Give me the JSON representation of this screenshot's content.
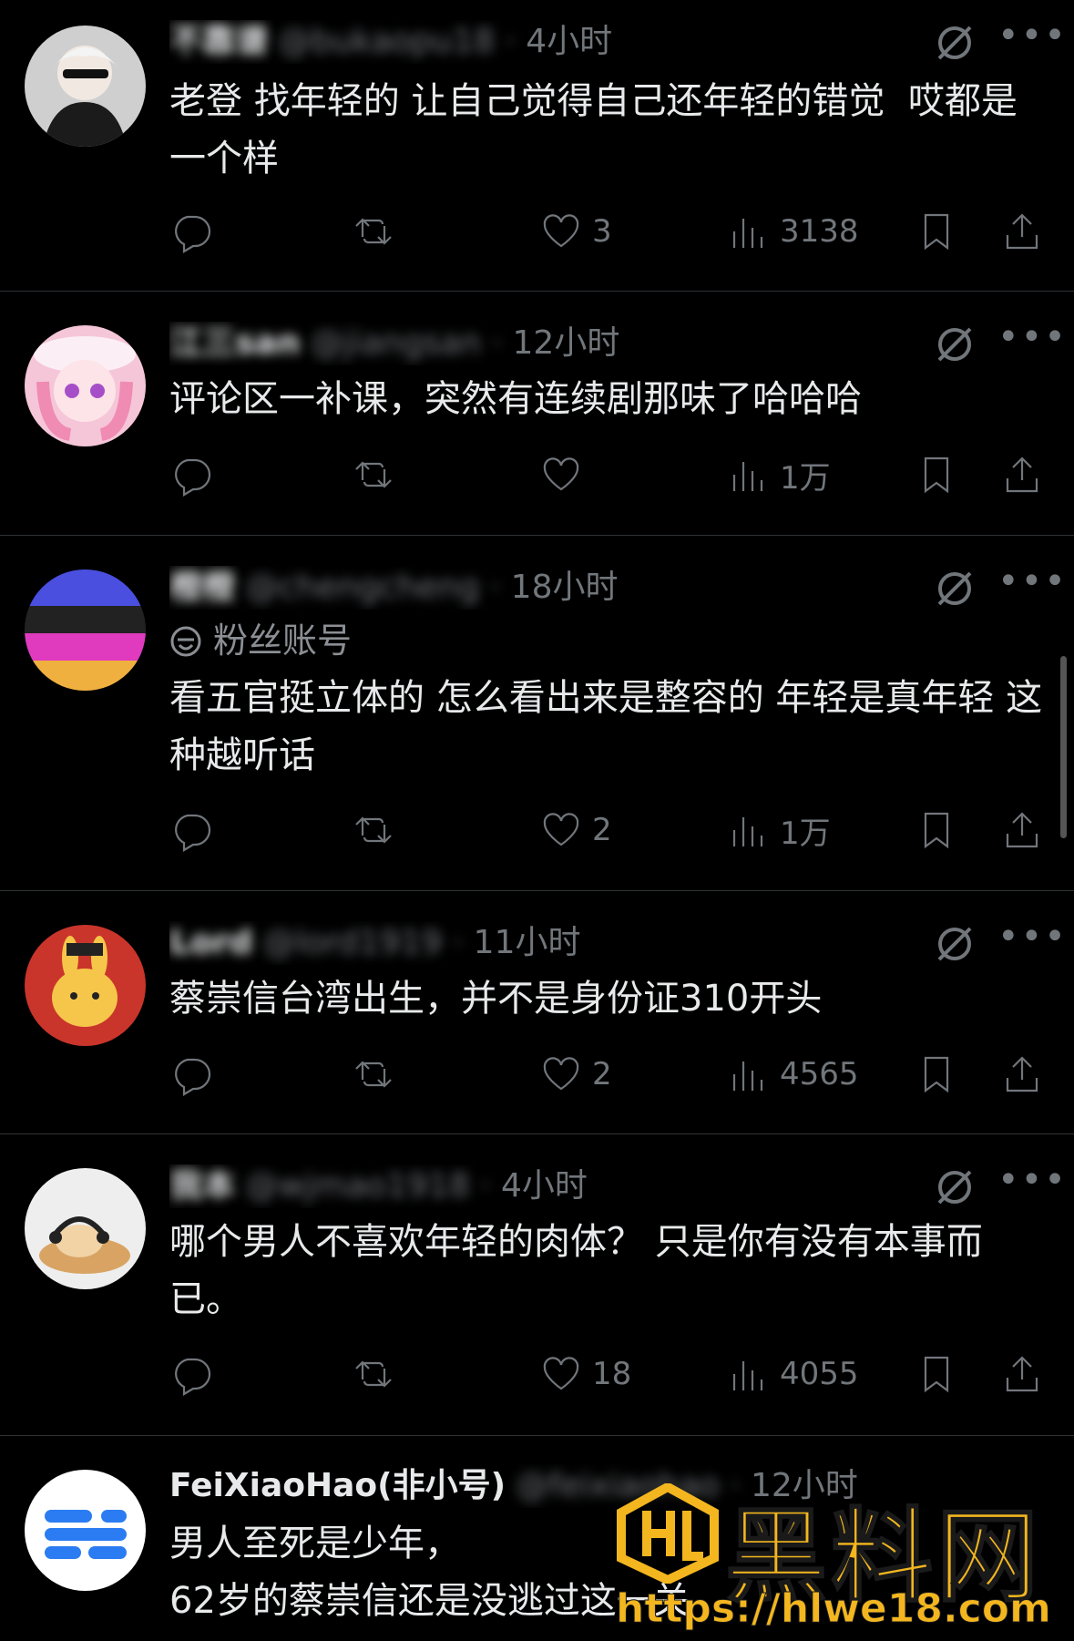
{
  "posts": [
    {
      "name": "不靠谱",
      "handle": "@bukaopu18 ·",
      "time": "4小时",
      "text": "老登 找年轻的 让自己觉得自己还年轻的错觉  哎都是一个样",
      "replies": "",
      "reposts": "",
      "likes": "3",
      "views": "3138"
    },
    {
      "name": "江三san",
      "handle": "@jiangsan ·",
      "time": "12小时",
      "text": "评论区一补课，突然有连续剧那味了哈哈哈",
      "replies": "",
      "reposts": "",
      "likes": "",
      "views": "1万"
    },
    {
      "name": "橙橙",
      "handle": "@chengcheng ·",
      "time": "18小时",
      "badge": "粉丝账号",
      "text": "看五官挺立体的 怎么看出来是整容的 年轻是真年轻 这种越听话",
      "replies": "",
      "reposts": "",
      "likes": "2",
      "views": "1万"
    },
    {
      "name": "Lord",
      "handle": "@lord1919 ·",
      "time": "11小时",
      "text": "蔡崇信台湾出生，并不是身份证310开头",
      "replies": "",
      "reposts": "",
      "likes": "2",
      "views": "4565"
    },
    {
      "name": "我本",
      "handle": "@wjmao1918 ·",
      "time": "4小时",
      "text": "哪个男人不喜欢年轻的肉体？ 只是你有没有本事而已。",
      "replies": "",
      "reposts": "",
      "likes": "18",
      "views": "4055"
    },
    {
      "name": "FeiXiaoHao(非小号)",
      "handle": "@feixiaohao ·",
      "time": "12小时",
      "text": "男人至死是少年，\n62岁的蔡崇信还是没逃过这一关",
      "replies": "",
      "reposts": "",
      "likes": "",
      "views": ""
    }
  ],
  "icons": {
    "reply": "reply-icon",
    "repost": "repost-icon",
    "like": "like-icon",
    "views": "views-icon",
    "bookmark": "bookmark-icon",
    "share": "share-icon",
    "grok": "grok-icon",
    "more": "more-icon"
  },
  "watermark": {
    "title": "黑料网",
    "url": "https://hlwe18.com"
  },
  "colors": {
    "background": "#000000",
    "text": "#e7e9ea",
    "muted": "#71767b",
    "divider": "#2f3336",
    "watermark": "#f3b61f"
  }
}
